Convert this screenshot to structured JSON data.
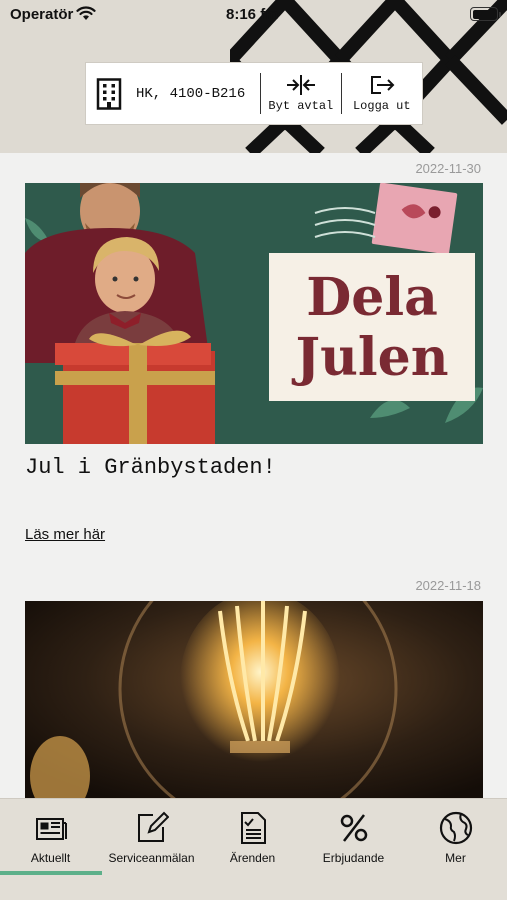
{
  "status": {
    "carrier": "Operatör",
    "time": "8:16 fm"
  },
  "account": {
    "id": "HK, 4100-B216",
    "switch_label": "Byt avtal",
    "logout_label": "Logga ut"
  },
  "posts": [
    {
      "date": "2022-11-30",
      "image_text": {
        "line1": "Dela",
        "line2": "Julen"
      },
      "title": "Jul i Gränbystaden!",
      "link": "Läs mer här"
    },
    {
      "date": "2022-11-18"
    }
  ],
  "tabs": [
    {
      "label": "Aktuellt",
      "icon": "newspaper-icon",
      "active": true
    },
    {
      "label": "Serviceanmälan",
      "icon": "edit-icon",
      "active": false
    },
    {
      "label": "Ärenden",
      "icon": "document-icon",
      "active": false
    },
    {
      "label": "Erbjudande",
      "icon": "percent-icon",
      "active": false
    },
    {
      "label": "Mer",
      "icon": "globe-icon",
      "active": false
    }
  ],
  "colors": {
    "accent": "#5db08a",
    "header_bg": "#dedad2",
    "card_green": "#2f5a4c",
    "brand_maroon": "#7a2a33"
  }
}
